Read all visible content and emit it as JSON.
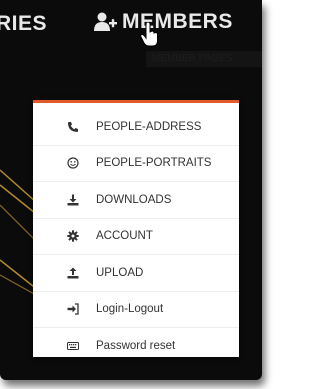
{
  "nav": {
    "prev_label": "RIES",
    "members_label": "MEMBERS",
    "tooltip": "MEMBER PAGES"
  },
  "colors": {
    "accent": "#e05a2b",
    "background": "#0b0b0b",
    "nav_text": "#e9e9e9",
    "menu_text": "#333333",
    "decor_lines": "#b08a2e"
  },
  "menu": {
    "items": [
      {
        "label": "PEOPLE-ADDRESS",
        "icon": "phone-icon"
      },
      {
        "label": "PEOPLE-PORTRAITS",
        "icon": "smiley-icon"
      },
      {
        "label": "DOWNLOADS",
        "icon": "download-icon"
      },
      {
        "label": "ACCOUNT",
        "icon": "gear-icon"
      },
      {
        "label": "UPLOAD",
        "icon": "upload-icon"
      },
      {
        "label": "Login-Logout",
        "icon": "sign-in-icon"
      },
      {
        "label": "Password reset",
        "icon": "keyboard-icon"
      }
    ]
  }
}
